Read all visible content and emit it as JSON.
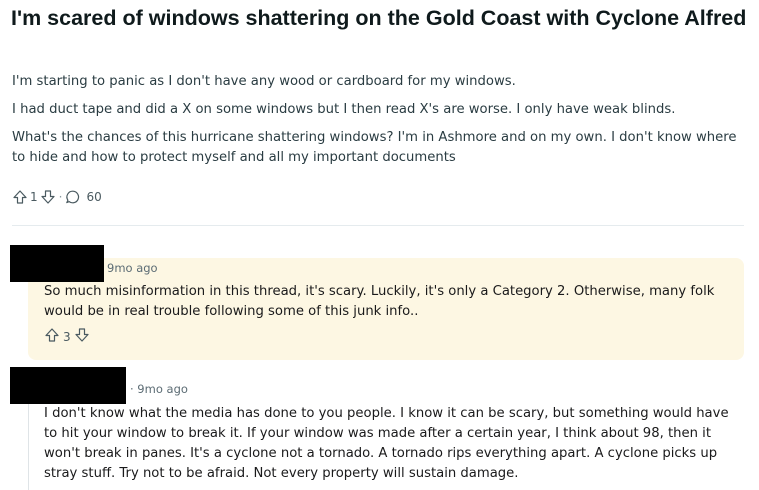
{
  "post": {
    "title": "I'm scared of windows shattering on the Gold Coast with Cyclone Alfred",
    "paragraphs": [
      "I'm starting to panic as I don't have any wood or cardboard for my windows.",
      "I had duct tape and did a X on some windows but I then read X's are worse. I only have weak blinds.",
      "What's the chances of this hurricane shattering windows? I'm in Ashmore and on my own. I don't know where to hide and how to protect myself and all my important documents"
    ],
    "upvotes": "1",
    "separator": "·",
    "comment_count": "60"
  },
  "comments": [
    {
      "time": "9mo ago",
      "body": "So much misinformation in this thread, it's scary. Luckily, it's only a Category 2. Otherwise, many folk would be in real trouble following some of this junk info..",
      "votes": "3",
      "highlight_color": "#fdf7e3"
    },
    {
      "time": "· 9mo ago",
      "body": "I don't know what the media has done to you people. I know it can be scary, but something would have to hit your window to break it. If your window was made after a certain year, I think about 98, then it won't break in panes. It's a cyclone not a tornado. A tornado rips everything apart. A cyclone picks up stray stuff. Try not to be afraid. Not every property will sustain damage."
    }
  ],
  "icons": {
    "upvote": "upvote-arrow-icon",
    "downvote": "downvote-arrow-icon",
    "comment": "comment-bubble-icon"
  }
}
